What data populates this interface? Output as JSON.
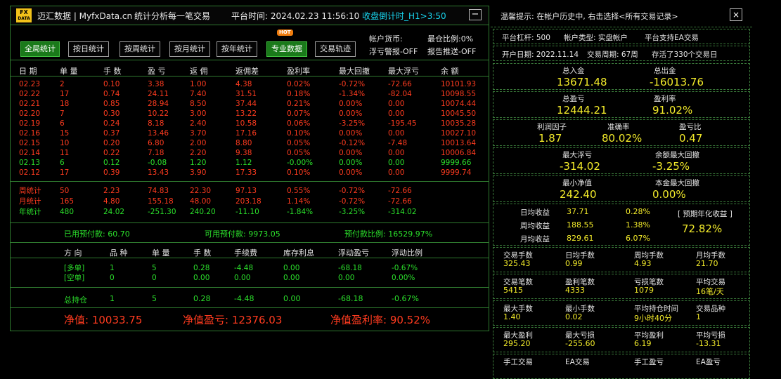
{
  "header": {
    "logo_top": "FX",
    "logo_bottom": "DATA",
    "site": "迈汇数据 | MyfxData.cn",
    "slogan": "统计分析每一笔交易",
    "time_label": "平台时间: 2024.02.23 11:56:10",
    "countdown": "收盘倒计时_H1>3:50",
    "minimize": "−"
  },
  "buttons": [
    "全局统计",
    "按日统计",
    "按周统计",
    "按月统计",
    "按年统计",
    "专业数据",
    "交易轨迹"
  ],
  "hot_badge": "HOT",
  "account_info": {
    "currency": "帐户货币:",
    "warning": "浮亏警报-OFF",
    "close_ratio": "最仓比例:0%",
    "push": "报告推送-OFF"
  },
  "table": {
    "headers": [
      "日 期",
      "单 量",
      "手 数",
      "盈 亏",
      "返 佣",
      "返佣差",
      "盈利率",
      "最大回撤",
      "最大浮亏",
      "余 额"
    ],
    "rows": [
      {
        "c": [
          "02.23",
          "2",
          "0.10",
          "3.38",
          "1.00",
          "4.38",
          "0.02%",
          "-0.72%",
          "-72.66",
          "10101.93"
        ],
        "color": "red"
      },
      {
        "c": [
          "02.22",
          "17",
          "0.74",
          "24.11",
          "7.40",
          "31.51",
          "0.18%",
          "-1.34%",
          "-82.04",
          "10098.55"
        ],
        "color": "red"
      },
      {
        "c": [
          "02.21",
          "18",
          "0.85",
          "28.94",
          "8.50",
          "37.44",
          "0.21%",
          "0.00%",
          "0.00",
          "10074.44"
        ],
        "color": "red"
      },
      {
        "c": [
          "02.20",
          "7",
          "0.30",
          "10.22",
          "3.00",
          "13.22",
          "0.07%",
          "0.00%",
          "0.00",
          "10045.50"
        ],
        "color": "red"
      },
      {
        "c": [
          "02.19",
          "6",
          "0.24",
          "8.18",
          "2.40",
          "10.58",
          "0.06%",
          "-3.25%",
          "-195.45",
          "10035.28"
        ],
        "color": "red"
      },
      {
        "c": [
          "02.16",
          "15",
          "0.37",
          "13.46",
          "3.70",
          "17.16",
          "0.10%",
          "0.00%",
          "0.00",
          "10027.10"
        ],
        "color": "red"
      },
      {
        "c": [
          "02.15",
          "10",
          "0.20",
          "6.80",
          "2.00",
          "8.80",
          "0.05%",
          "-0.12%",
          "-7.48",
          "10013.64"
        ],
        "color": "red"
      },
      {
        "c": [
          "02.14",
          "11",
          "0.22",
          "7.18",
          "2.20",
          "9.38",
          "0.05%",
          "0.00%",
          "0.00",
          "10006.84"
        ],
        "color": "red"
      },
      {
        "c": [
          "02.13",
          "6",
          "0.12",
          "-0.08",
          "1.20",
          "1.12",
          "-0.00%",
          "0.00%",
          "0.00",
          "9999.66"
        ],
        "color": "green"
      },
      {
        "c": [
          "02.12",
          "17",
          "0.39",
          "13.43",
          "3.90",
          "17.33",
          "0.10%",
          "0.00%",
          "0.00",
          "9999.74"
        ],
        "color": "red"
      }
    ],
    "summary": [
      {
        "c": [
          "周统计",
          "50",
          "2.23",
          "74.83",
          "22.30",
          "97.13",
          "0.55%",
          "-0.72%",
          "-72.66",
          ""
        ],
        "color": "red"
      },
      {
        "c": [
          "月统计",
          "165",
          "4.80",
          "155.18",
          "48.00",
          "203.18",
          "1.14%",
          "-0.72%",
          "-72.66",
          ""
        ],
        "color": "red"
      },
      {
        "c": [
          "年统计",
          "480",
          "24.02",
          "-251.30",
          "240.20",
          "-11.10",
          "-1.84%",
          "-3.25%",
          "-314.02",
          ""
        ],
        "color": "green"
      }
    ]
  },
  "margin": {
    "used": "已用预付款: 60.70",
    "free": "可用预付款: 9973.05",
    "ratio": "预付款比例: 16529.97%"
  },
  "positions": {
    "headers": [
      "方 向",
      "品 种",
      "单 量",
      "手 数",
      "手续费",
      "库存利息",
      "浮动盈亏",
      "浮动比例"
    ],
    "rows": [
      [
        "[多单]",
        "1",
        "5",
        "0.28",
        "-4.48",
        "0.00",
        "-68.18",
        "-0.67%"
      ],
      [
        "[空单]",
        "0",
        "0",
        "0.00",
        "0.00",
        "0.00",
        "0.00",
        "0.00%"
      ]
    ],
    "total": [
      "总持仓",
      "1",
      "5",
      "0.28",
      "-4.48",
      "0.00",
      "-68.18",
      "-0.67%"
    ]
  },
  "footer": {
    "equity": "净值: 10033.75",
    "equity_pl": "净值盈亏: 12376.03",
    "equity_rate": "净值盈利率: 90.52%"
  },
  "right": {
    "tip": "温馨提示: 在帐户历史中, 右击选择<所有交易记录>",
    "close": "×",
    "leverage": "平台杠杆: 500",
    "acct_type": "帐户类型: 实盘帐户",
    "ea": "平台支持EA交易",
    "open_date": "开户日期: 2022.11.14",
    "cycle": "交易周期: 67周",
    "records": "存活了330个交易日",
    "total_in_label": "总入金",
    "total_in": "13671.48",
    "total_out_label": "总出金",
    "total_out": "-16013.76",
    "total_pl_label": "总盈亏",
    "total_pl": "12444.21",
    "profit_rate_label": "盈利率",
    "profit_rate": "91.02%",
    "pf_label": "利润因子",
    "pf": "1.87",
    "acc_label": "准确率",
    "acc": "80.02%",
    "plr_label": "盈亏比",
    "plr": "0.47",
    "max_float_label": "最大浮亏",
    "max_float": "-314.02",
    "max_dd_label": "余额最大回撤",
    "max_dd": "-3.25%",
    "min_eq_label": "最小净值",
    "min_eq": "242.40",
    "cap_dd_label": "本金最大回撤",
    "cap_dd": "0.00%",
    "daily_label": "日均收益",
    "daily": "37.71",
    "daily_pct": "0.28%",
    "weekly_label": "周均收益",
    "weekly": "188.55",
    "weekly_pct": "1.38%",
    "monthly_label": "月均收益",
    "monthly": "829.61",
    "monthly_pct": "6.07%",
    "annual_label": "[ 预期年化收益 ]",
    "annual": "72.82%",
    "grid": [
      [
        [
          "交易手数",
          "325.43"
        ],
        [
          "日均手数",
          "0.99"
        ],
        [
          "周均手数",
          "4.93"
        ],
        [
          "月均手数",
          "21.70"
        ]
      ],
      [
        [
          "交易笔数",
          "5415"
        ],
        [
          "盈利笔数",
          "4333"
        ],
        [
          "亏损笔数",
          "1079"
        ],
        [
          "平均交易",
          "16笔/天"
        ]
      ],
      [
        [
          "最大手数",
          "1.40"
        ],
        [
          "最小手数",
          "0.02"
        ],
        [
          "平均持仓时间",
          "9小时40分"
        ],
        [
          "交易品种",
          "1"
        ]
      ],
      [
        [
          "最大盈利",
          "295.20"
        ],
        [
          "最大亏损",
          "-255.60"
        ],
        [
          "平均盈利",
          "6.19"
        ],
        [
          "平均亏损",
          "-13.31"
        ]
      ],
      [
        [
          "手工交易",
          ""
        ],
        [
          "EA交易",
          ""
        ],
        [
          "手工盈亏",
          ""
        ],
        [
          "EA盈亏",
          ""
        ]
      ]
    ]
  },
  "colors": {
    "border": "#2f7a2f",
    "accent_green": "#1a7a1a",
    "profit_red": "#ff3b1f",
    "loss_green": "#2be02b",
    "value_yellow": "#f2ea2a",
    "cyan": "#19d6f0"
  }
}
